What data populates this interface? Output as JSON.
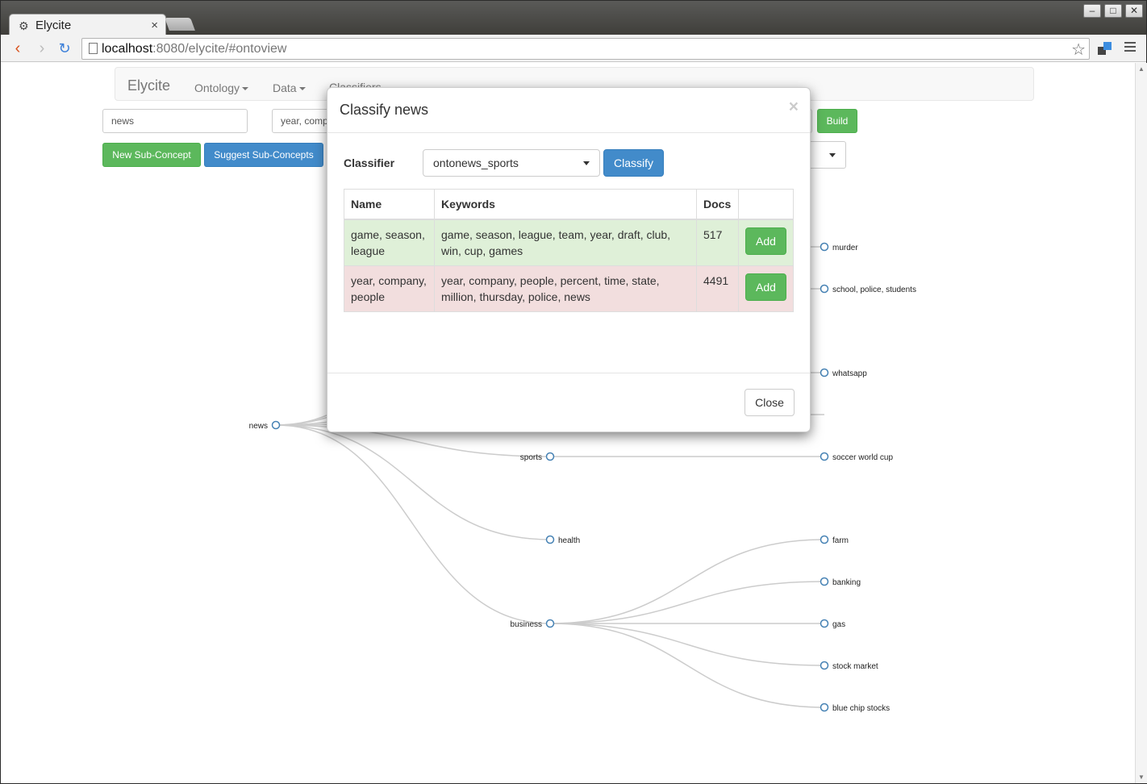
{
  "browser": {
    "tab_title": "Elycite",
    "tab_close": "×",
    "url_host": "localhost",
    "url_path": ":8080/elycite/#ontoview",
    "window_buttons": [
      "–",
      "□",
      "✕"
    ]
  },
  "navbar": {
    "brand": "Elycite",
    "items": [
      {
        "label": "Ontology"
      },
      {
        "label": "Data"
      },
      {
        "label": "Classifiers"
      }
    ]
  },
  "controls": {
    "concept_name_value": "news",
    "keywords_value": "year, company",
    "build_label": "Build",
    "new_subconcept_label": "New Sub-Concept",
    "suggest_subconcepts_label": "Suggest Sub-Concepts"
  },
  "tree": {
    "root": "news",
    "visible_nodes": [
      "sports",
      "health",
      "business",
      "murder",
      "school, police, students",
      "whatsapp",
      "soccer world cup",
      "farm",
      "banking",
      "gas",
      "stock market",
      "blue chip stocks"
    ]
  },
  "modal": {
    "title": "Classify news",
    "close_x": "×",
    "classifier_label": "Classifier",
    "classifier_selected": "ontonews_sports",
    "classify_label": "Classify",
    "columns": [
      "Name",
      "Keywords",
      "Docs",
      ""
    ],
    "rows": [
      {
        "status": "success",
        "name": "game, season, league",
        "keywords": "game, season, league, team, year, draft, club, win, cup, games",
        "docs": "517",
        "action": "Add"
      },
      {
        "status": "danger",
        "name": "year, company, people",
        "keywords": "year, company, people, percent, time, state, million, thursday, police, news",
        "docs": "4491",
        "action": "Add"
      }
    ],
    "close_label": "Close"
  },
  "colors": {
    "success": "#5cb85c",
    "primary": "#428bca",
    "row_success": "#dff0d8",
    "row_danger": "#f2dede",
    "node_stroke": "#4682b4"
  }
}
